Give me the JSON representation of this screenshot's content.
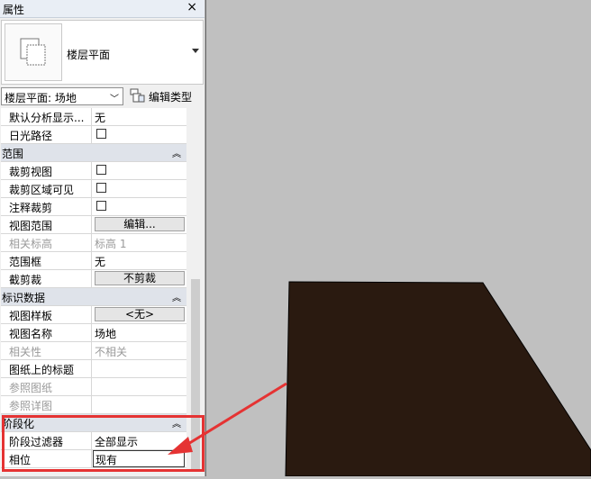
{
  "panel": {
    "title": "属性",
    "close_glyph": "×",
    "type_selector": {
      "name": "楼层平面",
      "icon": "floor-plan-type-icon"
    },
    "view_selector": {
      "value": "楼层平面: 场地"
    },
    "edit_type": {
      "label": "编辑类型",
      "icon": "edit-type-icon"
    }
  },
  "properties": {
    "rows": [
      {
        "label": "默认分析显示...",
        "value": "无"
      },
      {
        "label": "日光路径",
        "checkbox": false
      },
      {
        "group": "范围",
        "collapse": "︽"
      },
      {
        "label": "裁剪视图",
        "checkbox": false
      },
      {
        "label": "裁剪区域可见",
        "checkbox": false
      },
      {
        "label": "注释裁剪",
        "checkbox": false
      },
      {
        "label": "视图范围",
        "button": "编辑..."
      },
      {
        "label": "相关标高",
        "value": "标高 1",
        "disabled": true
      },
      {
        "label": "范围框",
        "value": "无"
      },
      {
        "label": "截剪裁",
        "button": "不剪裁"
      },
      {
        "group": "标识数据",
        "collapse": "︽"
      },
      {
        "label": "视图样板",
        "button": "<无>"
      },
      {
        "label": "视图名称",
        "value": "场地"
      },
      {
        "label": "相关性",
        "value": "不相关",
        "disabled": true
      },
      {
        "label": "图纸上的标题",
        "value": ""
      },
      {
        "label": "参照图纸",
        "value": "",
        "disabled": true
      },
      {
        "label": "参照详图",
        "value": "",
        "disabled": true
      },
      {
        "group": "阶段化",
        "collapse": "︽"
      },
      {
        "label": "阶段过滤器",
        "value": "全部显示"
      },
      {
        "label": "相位",
        "value": "现有",
        "editing": true
      }
    ]
  },
  "canvas": {
    "background": "#c0c0c0",
    "shape_color": "#2a1a10"
  },
  "annotation": {
    "color": "#e53333"
  }
}
